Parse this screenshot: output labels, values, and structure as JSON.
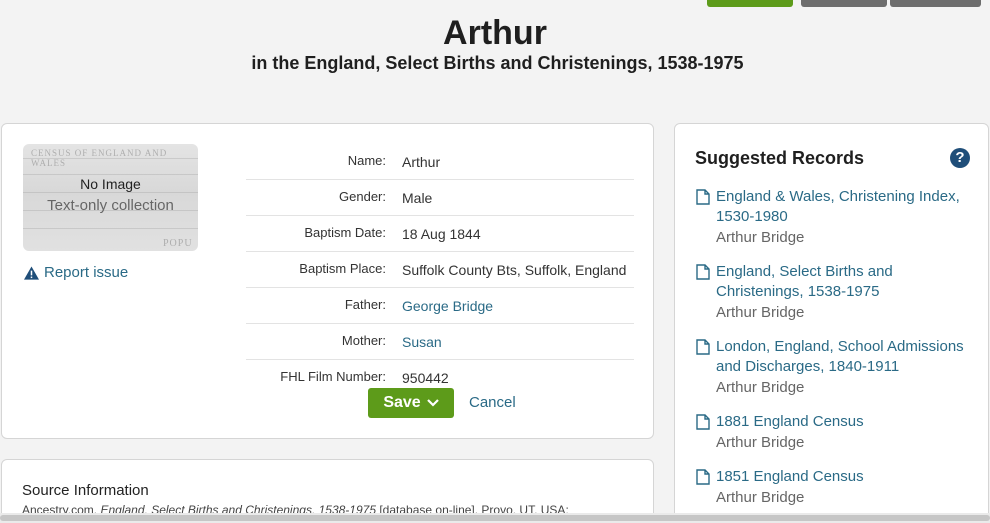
{
  "header": {
    "title": "Arthur",
    "subtitle": "in the England, Select Births and Christenings, 1538-1975"
  },
  "thumbnail": {
    "no_image": "No Image",
    "text_only": "Text-only collection",
    "ghost_text": "CENSUS OF ENGLAND AND WALES",
    "ghost_text2": "POPU"
  },
  "report_issue": "Report issue",
  "facts": [
    {
      "label": "Name:",
      "value": "Arthur",
      "link": false
    },
    {
      "label": "Gender:",
      "value": "Male",
      "link": false
    },
    {
      "label": "Baptism Date:",
      "value": "18 Aug 1844",
      "link": false
    },
    {
      "label": "Baptism Place:",
      "value": "Suffolk County Bts, Suffolk, England",
      "link": false
    },
    {
      "label": "Father:",
      "value": "George Bridge",
      "link": true
    },
    {
      "label": "Mother:",
      "value": "Susan",
      "link": true
    },
    {
      "label": "FHL Film Number:",
      "value": "950442",
      "link": false
    }
  ],
  "actions": {
    "save_label": "Save",
    "cancel_label": "Cancel"
  },
  "source": {
    "title": "Source Information",
    "text_prefix": "Ancestry.com.",
    "text_italic": "England, Select Births and Christenings, 1538-1975",
    "text_suffix": "[database on-line]. Provo, UT, USA:"
  },
  "suggested": {
    "title": "Suggested Records",
    "help": "?",
    "items": [
      {
        "record": "England & Wales, Christening Index, 1530-1980",
        "person": "Arthur Bridge"
      },
      {
        "record": "England, Select Births and Christenings, 1538-1975",
        "person": "Arthur Bridge"
      },
      {
        "record": "London, England, School Admissions and Discharges, 1840-1911",
        "person": "Arthur Bridge"
      },
      {
        "record": "1881 England Census",
        "person": "Arthur Bridge"
      },
      {
        "record": "1851 England Census",
        "person": "Arthur Bridge"
      }
    ]
  },
  "colors": {
    "accent_green": "#5d9b1a",
    "link_blue": "#2a6a86",
    "help_blue": "#1f4e79"
  }
}
